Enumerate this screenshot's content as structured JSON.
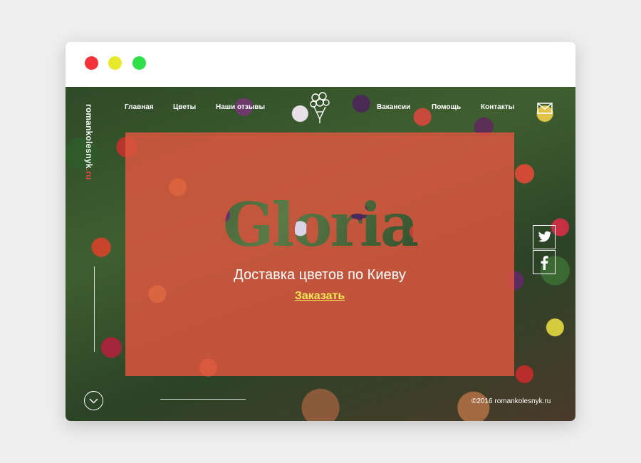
{
  "window": {
    "controls": [
      "close",
      "minimize",
      "maximize"
    ],
    "colors": {
      "close": "#f4323c",
      "minimize": "#e6ea2b",
      "maximize": "#2fe04a"
    }
  },
  "site": {
    "brand_main": "romankolesnyk",
    "brand_accent": ".ru",
    "overlay_color": "#da563f"
  },
  "nav": {
    "items_left": [
      "Главная",
      "Цветы",
      "Наши отзывы"
    ],
    "items_right": [
      "Вакансии",
      "Помощь",
      "Контакты"
    ],
    "logo_icon": "flower-bouquet-icon",
    "mail_icon": "envelope-icon"
  },
  "hero": {
    "title": "Gloria",
    "subtitle": "Доставка цветов по Киеву",
    "cta": "Заказать",
    "cta_color": "#f5e65a"
  },
  "social": {
    "items": [
      "twitter-icon",
      "facebook-icon"
    ]
  },
  "footer": {
    "scroll_icon": "chevron-down-icon",
    "copyright": "©2016 romankolesnyk.ru"
  }
}
